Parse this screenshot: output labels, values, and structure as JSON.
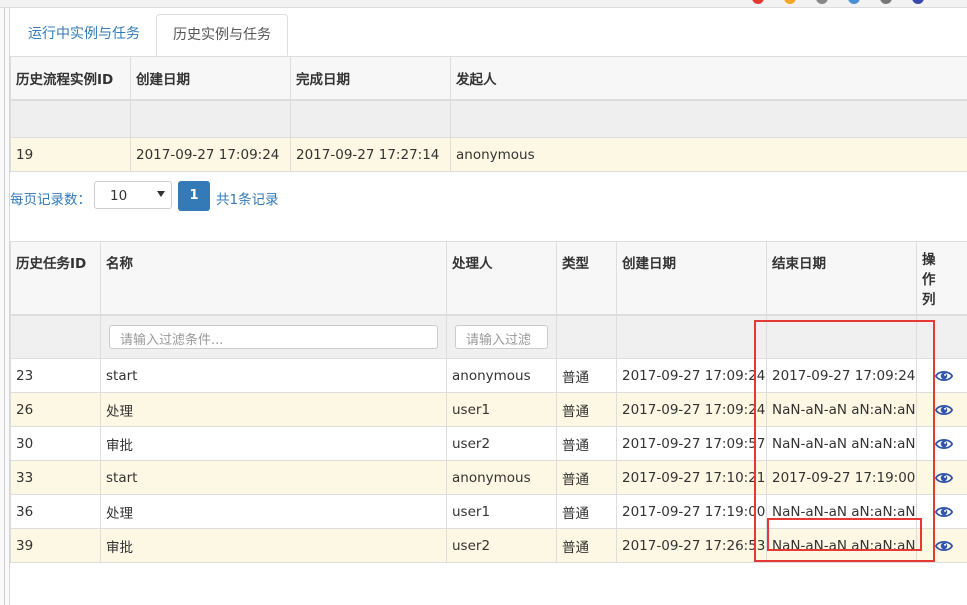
{
  "tabs": [
    {
      "label": "运行中实例与任务"
    },
    {
      "label": "历史实例与任务"
    }
  ],
  "instances": {
    "headers": [
      "历史流程实例ID",
      "创建日期",
      "完成日期",
      "发起人"
    ],
    "rows": [
      {
        "id": "19",
        "created": "2017-09-27 17:09:24",
        "finished": "2017-09-27 17:27:14",
        "starter": "anonymous"
      }
    ]
  },
  "pager": {
    "label": "每页记录数：",
    "page_size": "10",
    "current_page": "1",
    "total": "共1条记录"
  },
  "tasks": {
    "headers": [
      "历史任务ID",
      "名称",
      "处理人",
      "类型",
      "创建日期",
      "结束日期",
      "操作列"
    ],
    "filter_name_placeholder": "请输入过滤条件...",
    "filter_assignee_placeholder": "请输入过滤",
    "rows": [
      {
        "id": "23",
        "name": "start",
        "assignee": "anonymous",
        "type": "普通",
        "created": "2017-09-27 17:09:24",
        "ended": "2017-09-27 17:09:24"
      },
      {
        "id": "26",
        "name": "处理",
        "assignee": "user1",
        "type": "普通",
        "created": "2017-09-27 17:09:24",
        "ended": "NaN-aN-aN aN:aN:aN"
      },
      {
        "id": "30",
        "name": "审批",
        "assignee": "user2",
        "type": "普通",
        "created": "2017-09-27 17:09:57",
        "ended": "NaN-aN-aN aN:aN:aN"
      },
      {
        "id": "33",
        "name": "start",
        "assignee": "anonymous",
        "type": "普通",
        "created": "2017-09-27 17:10:21",
        "ended": "2017-09-27 17:19:00"
      },
      {
        "id": "36",
        "name": "处理",
        "assignee": "user1",
        "type": "普通",
        "created": "2017-09-27 17:19:00",
        "ended": "NaN-aN-aN aN:aN:aN"
      },
      {
        "id": "39",
        "name": "审批",
        "assignee": "user2",
        "type": "普通",
        "created": "2017-09-27 17:26:53",
        "ended": "NaN-aN-aN aN:aN:aN"
      }
    ],
    "action_icon": "eye-icon"
  },
  "colors": {
    "accent": "#337ab7",
    "highlight_row": "#fcf8e3",
    "annotation_red": "#e53935"
  }
}
